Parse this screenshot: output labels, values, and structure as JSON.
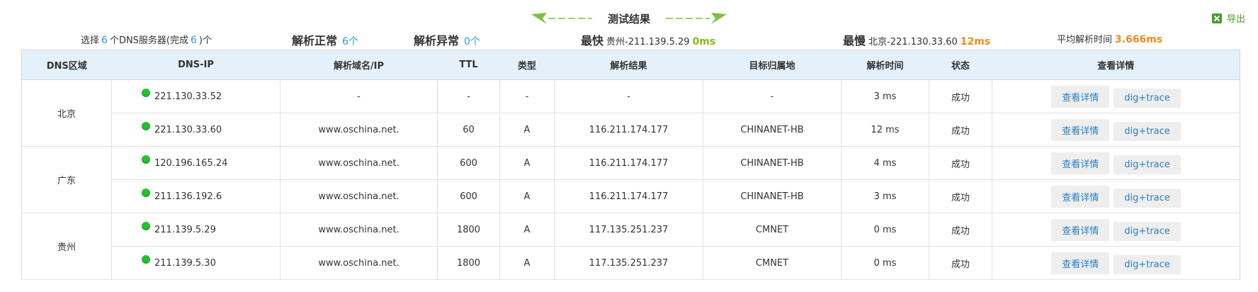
{
  "title": "测试结果",
  "export_label": "导出",
  "summary": {
    "select_prefix": "选择",
    "select_count": "6",
    "select_mid": "个DNS服务器(完成",
    "select_done": "6",
    "select_suffix": ")个",
    "normal_label": "解析正常",
    "normal_count": "6个",
    "abnormal_label": "解析异常",
    "abnormal_count": "0个",
    "fastest_label": "最快",
    "fastest_server": "贵州-211.139.5.29",
    "fastest_time": "0ms",
    "slowest_label": "最慢",
    "slowest_server": "北京-221.130.33.60",
    "slowest_time": "12ms",
    "avg_label": "平均解析时间",
    "avg_time": "3.666ms"
  },
  "columns": [
    "DNS区域",
    "DNS-IP",
    "解析域名/IP",
    "TTL",
    "类型",
    "解析结果",
    "目标归属地",
    "解析时间",
    "状态",
    "查看详情"
  ],
  "detail_label": "查看详情",
  "trace_label": "dig+trace",
  "regions": [
    "北京",
    "广东",
    "贵州"
  ],
  "rows": [
    {
      "ip": "221.130.33.52",
      "domain": "-",
      "ttl": "-",
      "type": "-",
      "result": "-",
      "location": "-",
      "time": "3 ms",
      "status": "成功"
    },
    {
      "ip": "221.130.33.60",
      "domain": "www.oschina.net.",
      "ttl": "60",
      "type": "A",
      "result": "116.211.174.177",
      "location": "CHINANET-HB",
      "time": "12 ms",
      "status": "成功"
    },
    {
      "ip": "120.196.165.24",
      "domain": "www.oschina.net.",
      "ttl": "600",
      "type": "A",
      "result": "116.211.174.177",
      "location": "CHINANET-HB",
      "time": "4 ms",
      "status": "成功"
    },
    {
      "ip": "211.136.192.6",
      "domain": "www.oschina.net.",
      "ttl": "600",
      "type": "A",
      "result": "116.211.174.177",
      "location": "CHINANET-HB",
      "time": "3 ms",
      "status": "成功"
    },
    {
      "ip": "211.139.5.29",
      "domain": "www.oschina.net.",
      "ttl": "1800",
      "type": "A",
      "result": "117.135.251.237",
      "location": "CMNET",
      "time": "0 ms",
      "status": "成功"
    },
    {
      "ip": "211.139.5.30",
      "domain": "www.oschina.net.",
      "ttl": "1800",
      "type": "A",
      "result": "117.135.251.237",
      "location": "CMNET",
      "time": "0 ms",
      "status": "成功"
    }
  ],
  "colors": {
    "accent_blue": "#2e9bd6",
    "fast_green": "#86b717",
    "slow_orange": "#ef8b1d",
    "header_bg": "#e4f1fa",
    "ok_dot": "#22c22f"
  }
}
